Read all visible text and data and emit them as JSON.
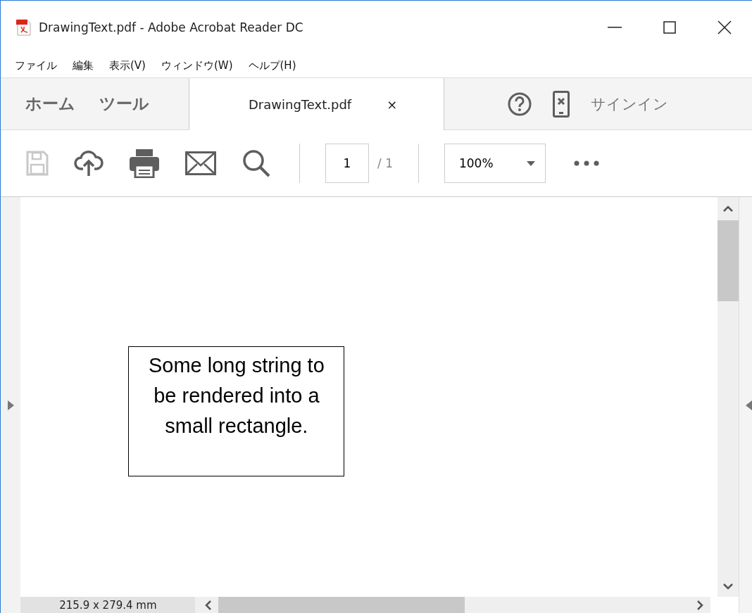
{
  "window": {
    "title": "DrawingText.pdf - Adobe Acrobat Reader DC"
  },
  "menu": [
    "ファイル",
    "編集",
    "表示(V)",
    "ウィンドウ(W)",
    "ヘルプ(H)"
  ],
  "tabs": [
    {
      "label": "ホーム",
      "selected": false,
      "kind": "nav"
    },
    {
      "label": "ツール",
      "selected": false,
      "kind": "nav"
    },
    {
      "label": "DrawingText.pdf",
      "selected": true,
      "kind": "document",
      "close": "×"
    }
  ],
  "sign_in": "サインイン",
  "toolbar": {
    "save_disabled": true,
    "page": "1",
    "page_total": "/ 1",
    "zoom": "100%"
  },
  "document": {
    "text_box": "Some long string to be rendered into a small rectangle."
  },
  "status_bar": {
    "page_size": "215.9 x 279.4 mm"
  }
}
